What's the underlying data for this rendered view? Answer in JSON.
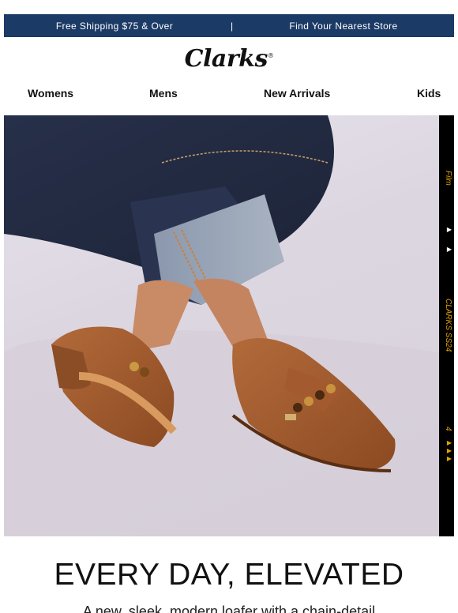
{
  "topbar": {
    "left_text": "Free Shipping $75 & Over",
    "divider": "|",
    "right_text": "Find Your Nearest Store",
    "bg_color": "#1c3a66"
  },
  "logo": {
    "text": "Clarks",
    "mark": "®"
  },
  "nav": {
    "items": [
      "Womens",
      "Mens",
      "New Arrivals",
      "Kids"
    ]
  },
  "hero": {
    "film_labels": [
      "Film",
      "CLARKS SS24",
      "4"
    ],
    "accent_color": "#e0a200"
  },
  "headline": "EVERY DAY, ELEVATED",
  "subtext": "A new, sleek, modern loafer with a chain-detail"
}
